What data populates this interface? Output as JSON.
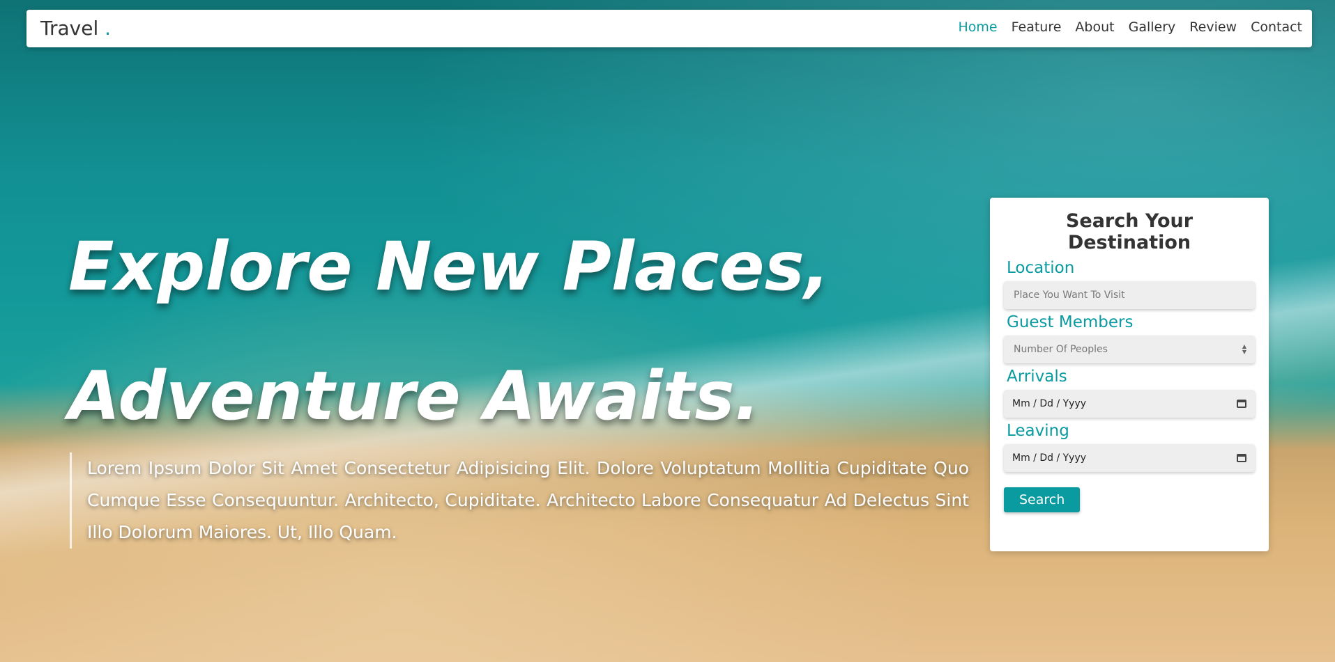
{
  "nav": {
    "logo_text": "Travel",
    "logo_dot": ".",
    "items": [
      "Home",
      "Feature",
      "About",
      "Gallery",
      "Review",
      "Contact"
    ],
    "active": "Home"
  },
  "hero": {
    "line1": "Explore New Places,",
    "line2": "Adventure Awaits.",
    "description": "Lorem Ipsum Dolor Sit Amet Consectetur Adipisicing Elit. Dolore Voluptatum Mollitia Cupiditate Quo Cumque Esse Consequuntur. Architecto, Cupiditate. Architecto Labore Consequatur Ad Delectus Sint Illo Dolorum Maiores. Ut, Illo Quam."
  },
  "search": {
    "title": "Search Your Destination",
    "location_label": "Location",
    "location_placeholder": "Place You Want To Visit",
    "guests_label": "Guest Members",
    "guests_placeholder": "Number Of Peoples",
    "arrivals_label": "Arrivals",
    "arrivals_value": "Mm / Dd / Yyyy",
    "leaving_label": "Leaving",
    "leaving_value": "Mm / Dd / Yyyy",
    "button_label": "Search"
  },
  "colors": {
    "accent": "#0a9ba0"
  }
}
